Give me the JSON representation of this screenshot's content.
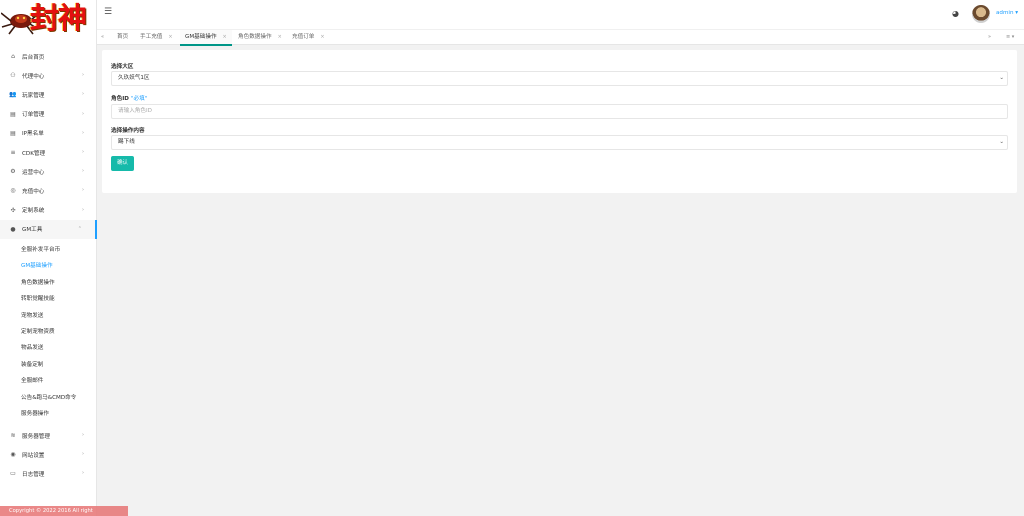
{
  "app": {
    "logo_text": "封神"
  },
  "sidebar": {
    "items": [
      {
        "label": "后台首页",
        "icon": "home-icon",
        "glyph": "⌂",
        "has_arrow": false
      },
      {
        "label": "代理中心",
        "icon": "agents-icon",
        "glyph": "⚇",
        "has_arrow": true
      },
      {
        "label": "玩家管理",
        "icon": "users-icon",
        "glyph": "👥",
        "has_arrow": true
      },
      {
        "label": "订单管理",
        "icon": "order-icon",
        "glyph": "▤",
        "has_arrow": true
      },
      {
        "label": "IP黑名单",
        "icon": "ip-icon",
        "glyph": "▤",
        "has_arrow": true
      },
      {
        "label": "CDK管理",
        "icon": "cdk-icon",
        "glyph": "≡",
        "has_arrow": true
      },
      {
        "label": "运营中心",
        "icon": "gear-icon",
        "glyph": "⚙",
        "has_arrow": true
      },
      {
        "label": "充值中心",
        "icon": "wallet-icon",
        "glyph": "◎",
        "has_arrow": true
      },
      {
        "label": "定制系统",
        "icon": "puzzle-icon",
        "glyph": "✣",
        "has_arrow": true
      },
      {
        "label": "GM工具",
        "icon": "bulb-icon",
        "glyph": "●",
        "has_arrow": true,
        "expanded": true
      }
    ],
    "gm_subitems": [
      "全服补发平台币",
      "GM基础操作",
      "角色数据操作",
      "转职觉醒技能",
      "宠物发送",
      "定制宠物资质",
      "物品发送",
      "装备定制",
      "全服邮件",
      "公告&跑马&CMD命令",
      "服务器操作"
    ],
    "gm_active_index": 1,
    "bottom_items": [
      {
        "label": "服务器管理",
        "icon": "wifi-icon",
        "glyph": "≋"
      },
      {
        "label": "网站设置",
        "icon": "globe-icon",
        "glyph": "◉"
      },
      {
        "label": "日志管理",
        "icon": "log-icon",
        "glyph": "▭"
      }
    ]
  },
  "footer": {
    "text": "Copyright © 2022 2016 All right"
  },
  "header": {
    "menu_icon": "☰",
    "palette_icon": "◕",
    "user_label": "admin ▾"
  },
  "tabs": {
    "prev_icon": "«",
    "next_icon": "»",
    "menu_icon": "≡ ▾",
    "items": [
      {
        "label": "首页",
        "closable": false,
        "active": false
      },
      {
        "label": "手工充值",
        "closable": true,
        "active": false
      },
      {
        "label": "GM基础操作",
        "closable": true,
        "active": true
      },
      {
        "label": "角色数据操作",
        "closable": true,
        "active": false
      },
      {
        "label": "充值订单",
        "closable": true,
        "active": false
      }
    ]
  },
  "form": {
    "region_label": "选择大区",
    "region_value": "久玖妖气1区",
    "role_label": "角色ID",
    "role_hint": "\"必填\"",
    "role_placeholder": "请输入角色ID",
    "op_label": "选择操作内容",
    "op_value": "踢下线",
    "submit_label": "确认"
  },
  "colors": {
    "accent": "#1e9fff",
    "button": "#16baaa",
    "active_tab_line": "#009688"
  }
}
